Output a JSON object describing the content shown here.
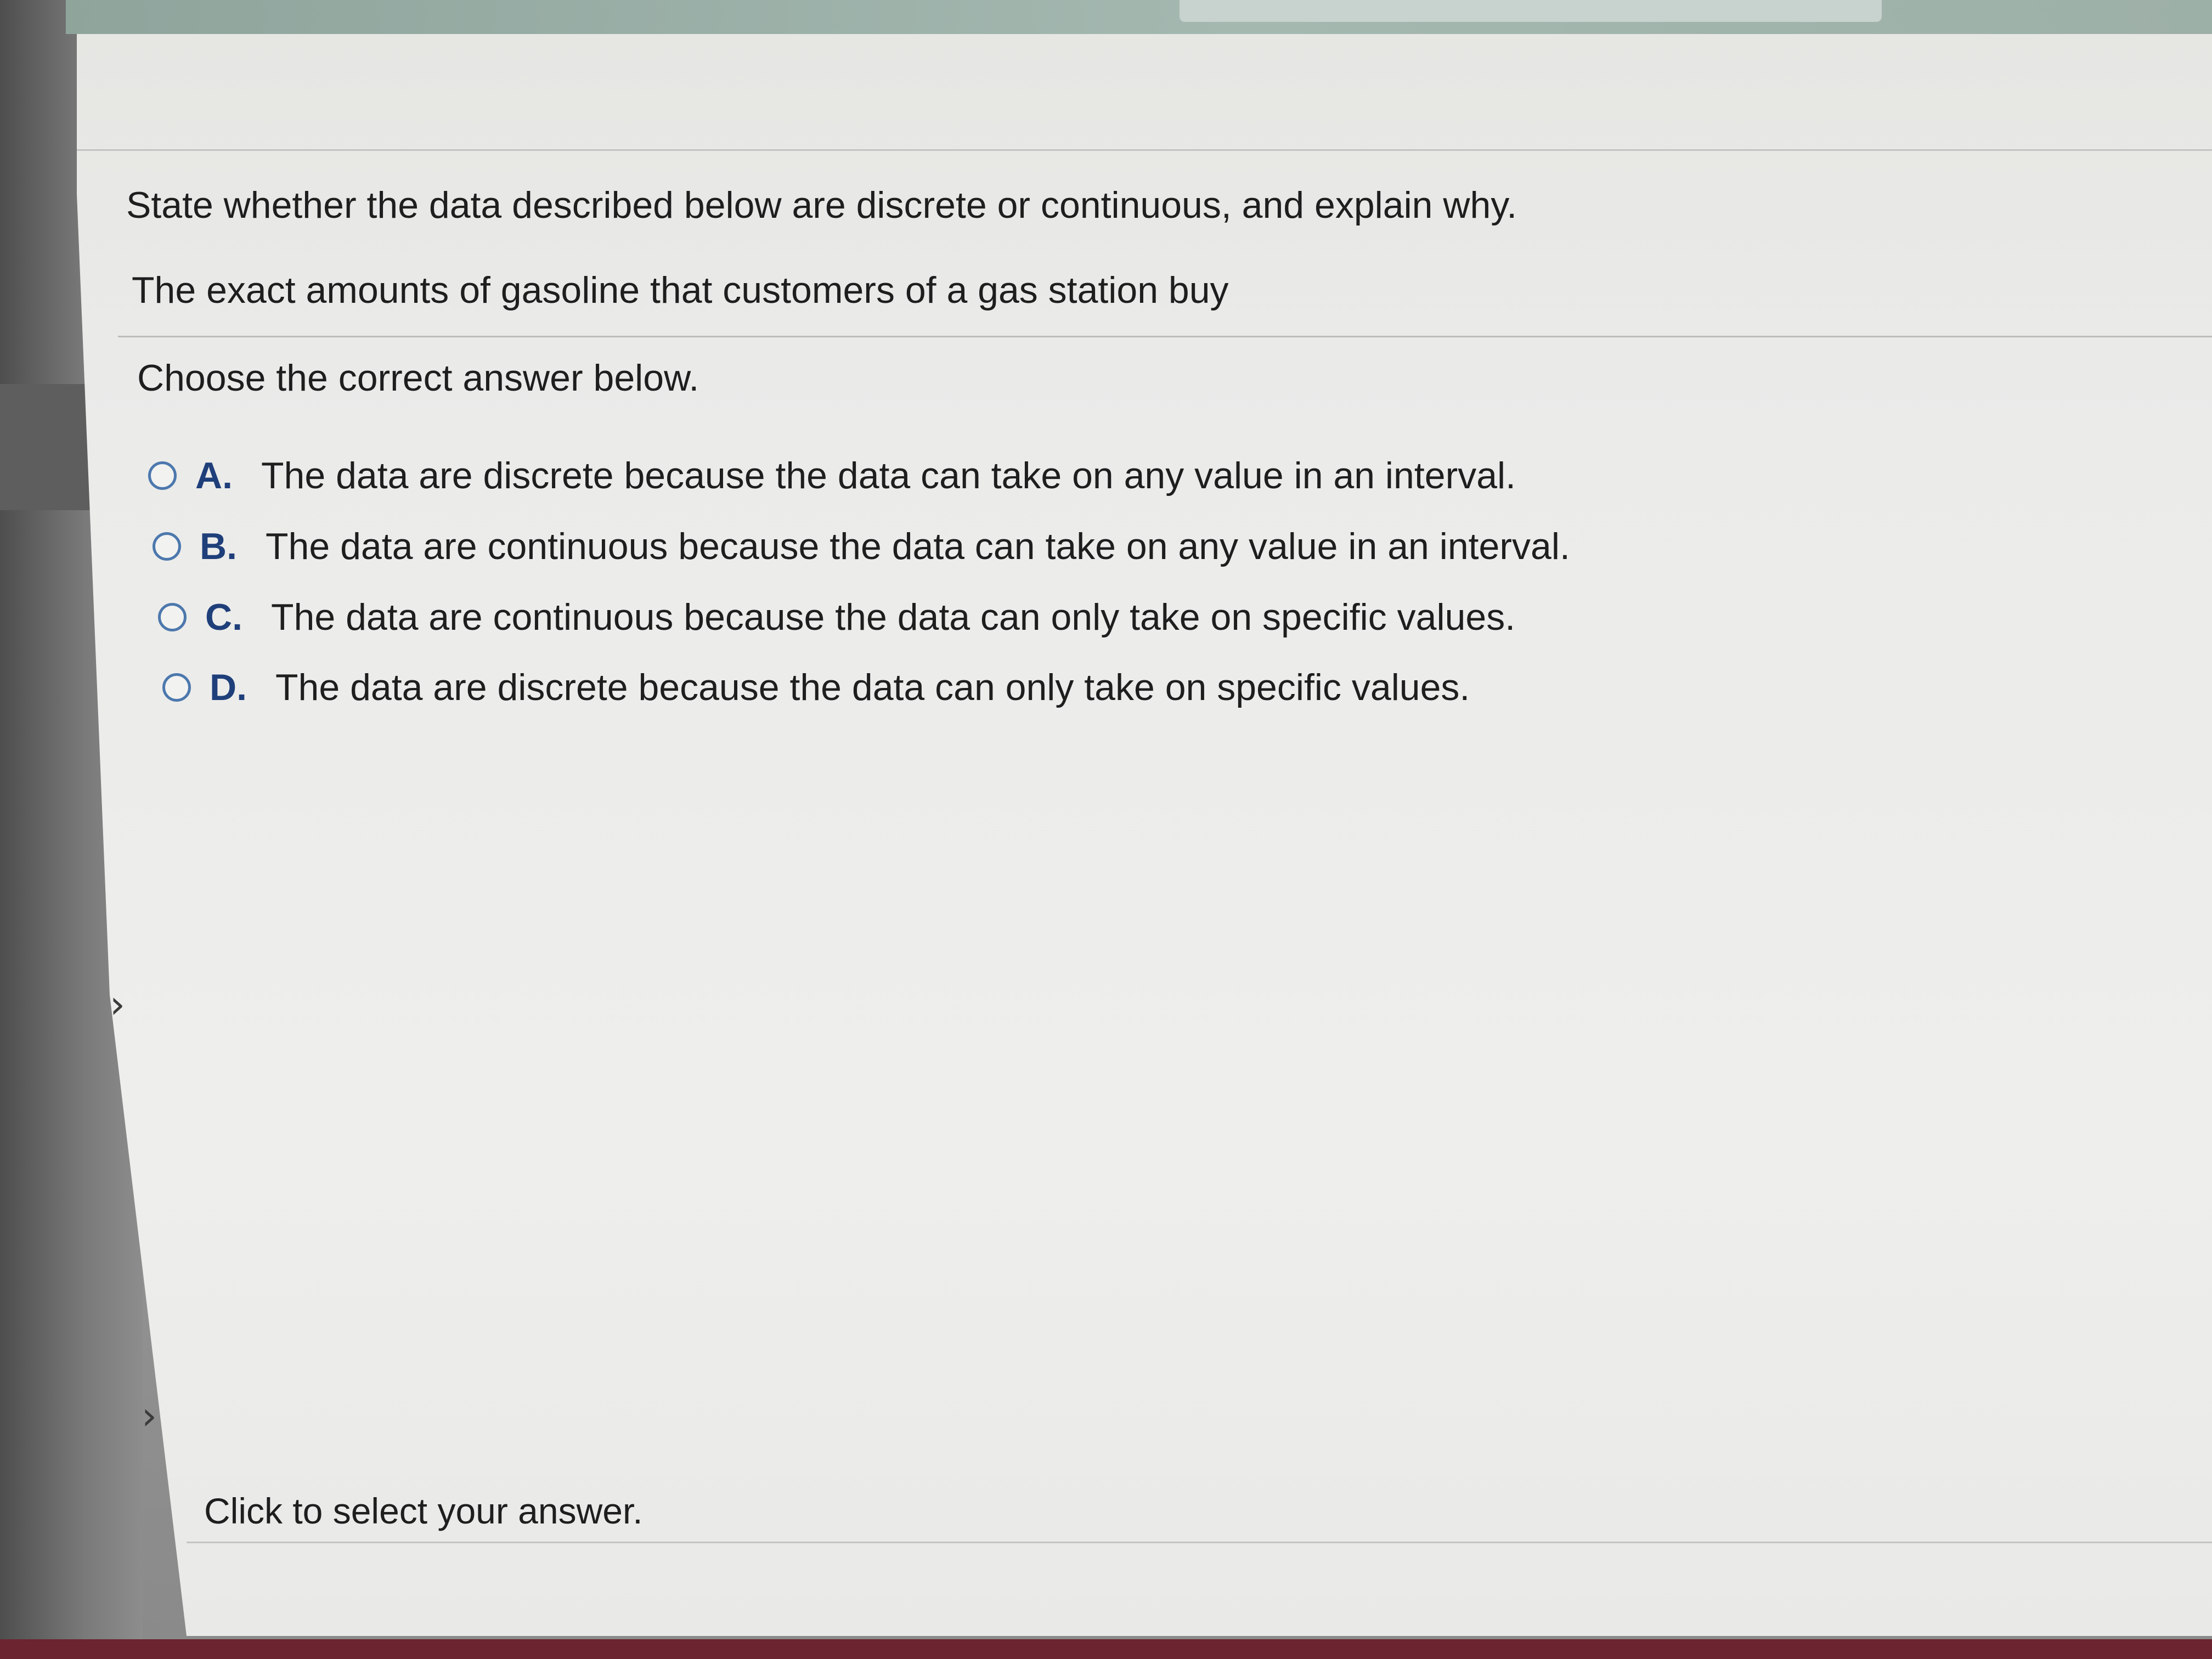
{
  "question": {
    "prompt": "State whether the data described below are discrete or continuous, and explain why.",
    "dataset": "The exact amounts of gasoline that customers of a gas station buy",
    "instruction": "Choose the correct answer below."
  },
  "options": [
    {
      "letter": "A.",
      "text": "The data are discrete because the data can take on any value in an interval."
    },
    {
      "letter": "B.",
      "text": "The data are continuous because the data can take on any value in an interval."
    },
    {
      "letter": "C.",
      "text": "The data are continuous because the data can only take on specific values."
    },
    {
      "letter": "D.",
      "text": "The data are discrete because the data can only take on specific values."
    }
  ],
  "nav": {
    "chevron_1": "›",
    "chevron_2": "›"
  },
  "status": {
    "text": "Click to select your answer."
  },
  "colors": {
    "radio_border": "#4c78ad",
    "option_letter": "#1f3f7a",
    "panel_background": "#ebebea"
  }
}
